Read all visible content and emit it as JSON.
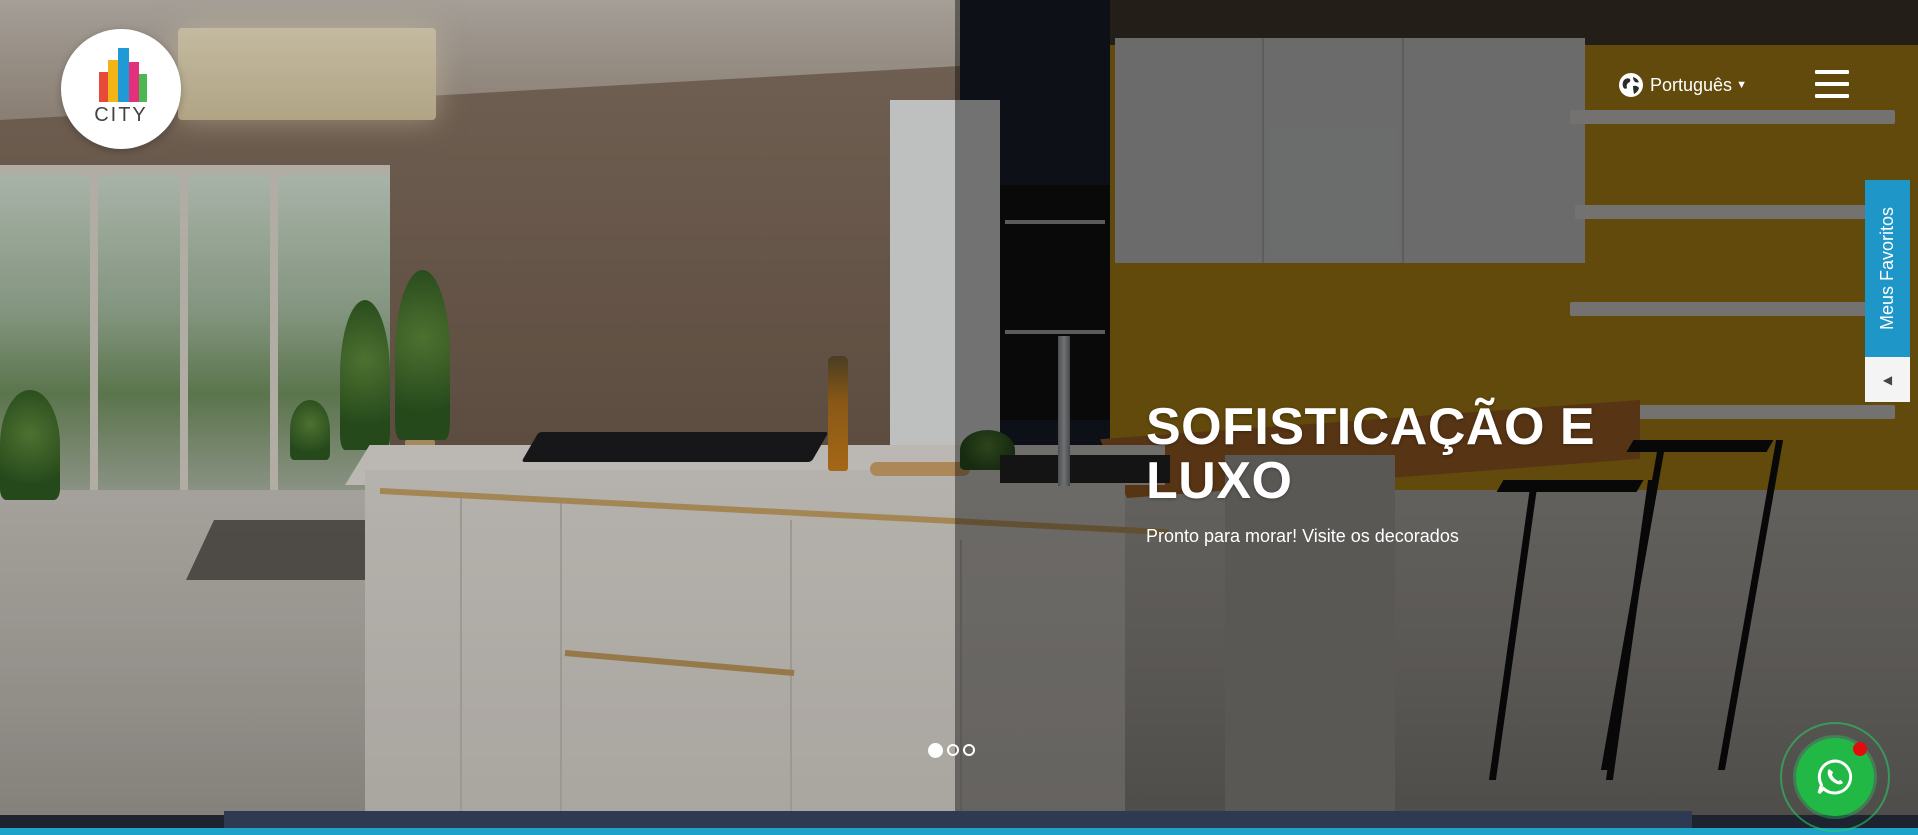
{
  "header": {
    "logo_text": "CITY",
    "language": {
      "label": "Português",
      "icon": "globe-icon"
    },
    "menu": {
      "icon": "hamburger-menu-icon"
    }
  },
  "favorites_tab": {
    "label": "Meus Favoritos",
    "toggle_icon": "triangle-left-icon"
  },
  "slide": {
    "title": "SOFISTICAÇÃO E LUXO",
    "subtitle": "Pronto para morar! Visite os decorados"
  },
  "carousel": {
    "dots": 3,
    "active_index": 0
  },
  "whatsapp": {
    "icon": "whatsapp-icon",
    "badge_color": "#e10d0d"
  },
  "colors": {
    "accent": "#1e96c8",
    "whatsapp": "#22b845",
    "bottom_bar": "#2e3a52"
  }
}
